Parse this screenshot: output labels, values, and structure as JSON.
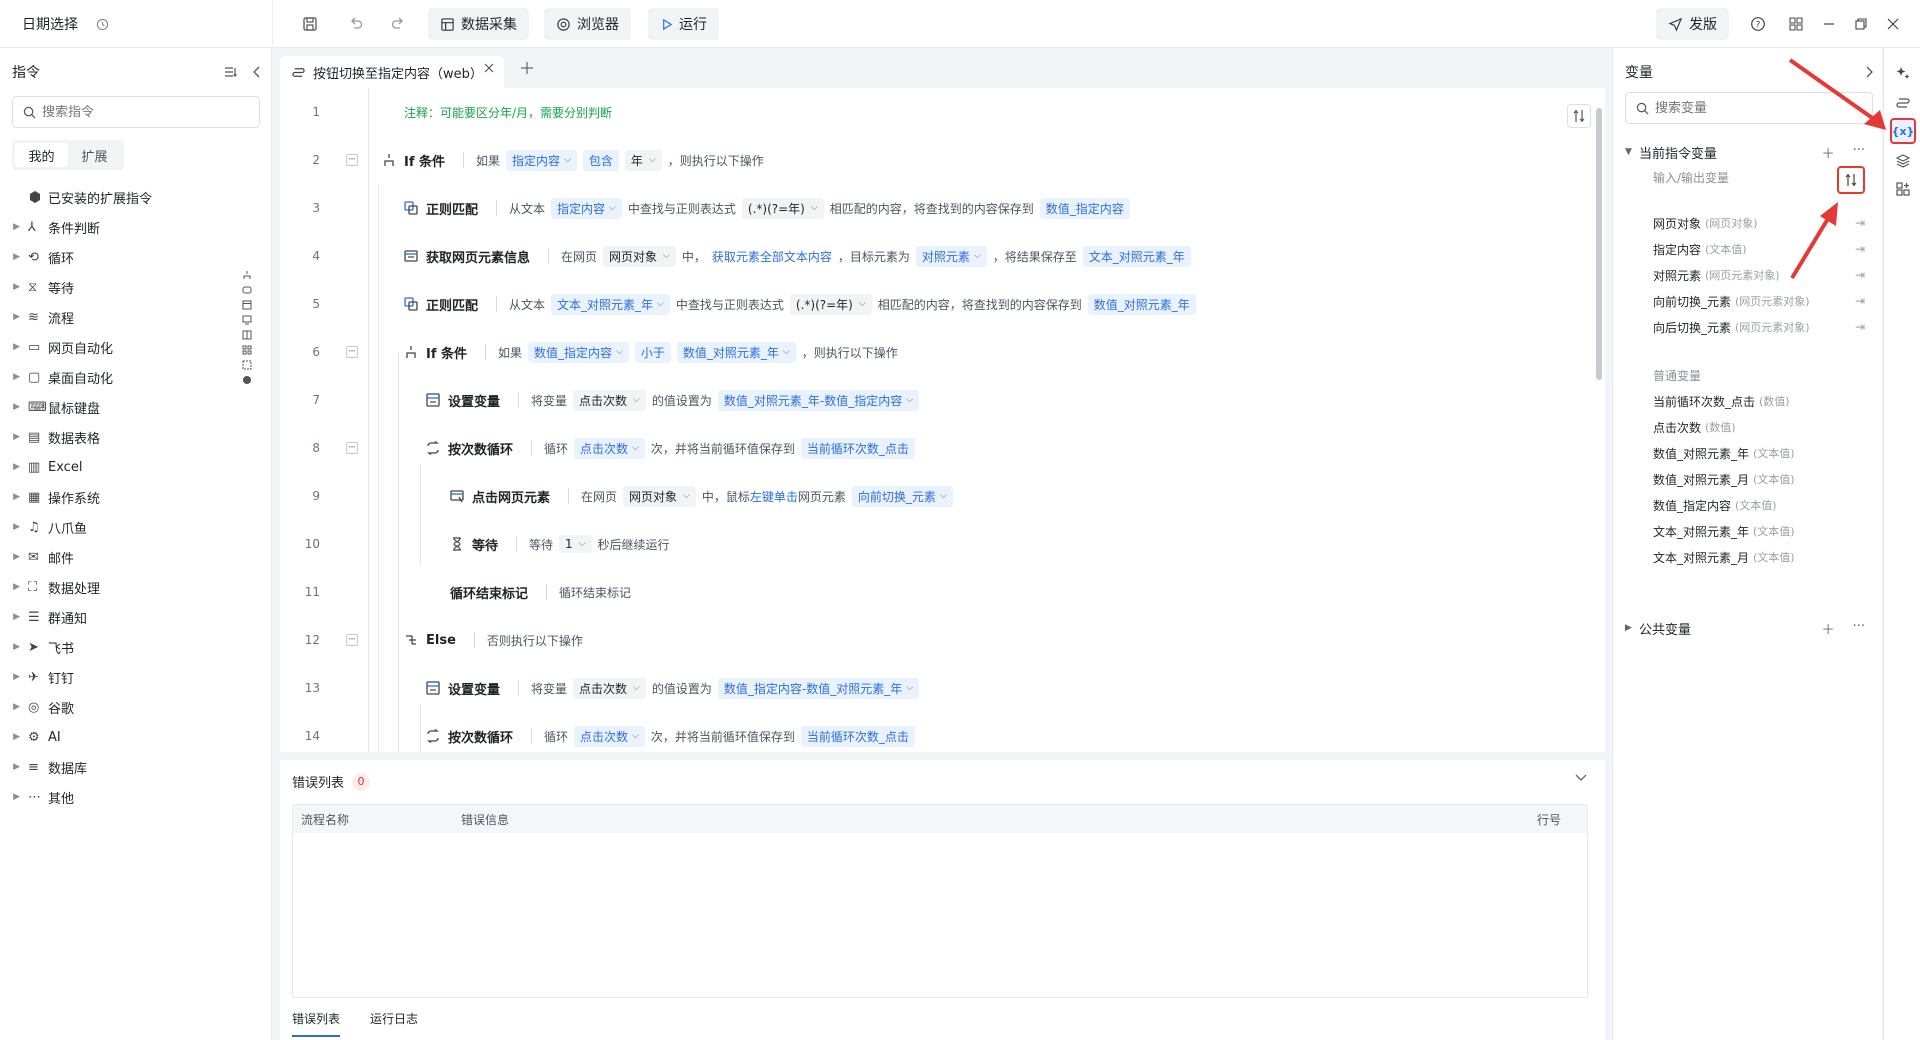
{
  "app": {
    "title": "日期选择"
  },
  "toolbar": {
    "data_collect": "数据采集",
    "browser": "浏览器",
    "run": "运行",
    "publish": "发版"
  },
  "left": {
    "title": "指令",
    "search_placeholder": "搜索指令",
    "tabs": [
      "我的",
      "扩展"
    ],
    "installed": "已安装的扩展指令",
    "items": [
      "条件判断",
      "循环",
      "等待",
      "流程",
      "网页自动化",
      "桌面自动化",
      "鼠标键盘",
      "数据表格",
      "Excel",
      "操作系统",
      "八爪鱼",
      "邮件",
      "数据处理",
      "群通知",
      "飞书",
      "钉钉",
      "谷歌",
      "AI",
      "数据库",
      "其他"
    ]
  },
  "editor": {
    "tab_title": "按钮切换至指定内容（web）",
    "lines": {
      "l1": {
        "comment": "注释：可能要区分年/月，需要分别判断"
      },
      "l2": {
        "cmd": "If 条件",
        "t1": "如果",
        "v1": "指定内容",
        "op": "包含",
        "v2": "年",
        "t2": "，则执行以下操作"
      },
      "l3": {
        "cmd": "正则匹配",
        "t1": "从文本",
        "v1": "指定内容",
        "t2": "中查找与正则表达式",
        "v2": "(.*)(?=年)",
        "t3": "相匹配的内容，将查找到的内容保存到",
        "v3": "数值_指定内容"
      },
      "l4": {
        "cmd": "获取网页元素信息",
        "t1": "在网页",
        "v1": "网页对象",
        "t2": "中，",
        "link": "获取元素全部文本内容",
        "t3": "，目标元素为",
        "v2": "对照元素",
        "t4": "，将结果保存至",
        "v3": "文本_对照元素_年"
      },
      "l5": {
        "cmd": "正则匹配",
        "t1": "从文本",
        "v1": "文本_对照元素_年",
        "t2": "中查找与正则表达式",
        "v2": "(.*)(?=年)",
        "t3": "相匹配的内容，将查找到的内容保存到",
        "v3": "数值_对照元素_年"
      },
      "l6": {
        "cmd": "If 条件",
        "t1": "如果",
        "v1": "数值_指定内容",
        "op": "小于",
        "v2": "数值_对照元素_年",
        "t2": "，则执行以下操作"
      },
      "l7": {
        "cmd": "设置变量",
        "t1": "将变量",
        "v1": "点击次数",
        "t2": "的值设置为",
        "v2": "数值_对照元素_年-数值_指定内容"
      },
      "l8": {
        "cmd": "按次数循环",
        "t1": "循环",
        "v1": "点击次数",
        "t2": "次，并将当前循环值保存到",
        "v2": "当前循环次数_点击"
      },
      "l9": {
        "cmd": "点击网页元素",
        "t1": "在网页",
        "v1": "网页对象",
        "t2": "中，鼠标",
        "link": "左键单击",
        "t3": "网页元素",
        "v2": "向前切换_元素"
      },
      "l10": {
        "cmd": "等待",
        "t1": "等待",
        "v1": "1",
        "t2": "秒后继续运行"
      },
      "l11": {
        "cmd": "循环结束标记",
        "t1": "循环结束标记"
      },
      "l12": {
        "cmd": "Else",
        "t1": "否则执行以下操作"
      },
      "l13": {
        "cmd": "设置变量",
        "t1": "将变量",
        "v1": "点击次数",
        "t2": "的值设置为",
        "v2": "数值_指定内容-数值_对照元素_年"
      },
      "l14": {
        "cmd": "按次数循环",
        "t1": "循环",
        "v1": "点击次数",
        "t2": "次，并将当前循环值保存到",
        "v2": "当前循环次数_点击"
      }
    }
  },
  "errors": {
    "title": "错误列表",
    "count": "0",
    "col_name": "流程名称",
    "col_msg": "错误信息",
    "col_line": "行号",
    "tab_errors": "错误列表",
    "tab_log": "运行日志"
  },
  "vars": {
    "title": "变量",
    "search_placeholder": "搜索变量",
    "current_group": "当前指令变量",
    "io_head": "输入/输出变量",
    "io": [
      {
        "name": "网页对象",
        "type": "(网页对象)"
      },
      {
        "name": "指定内容",
        "type": "(文本值)"
      },
      {
        "name": "对照元素",
        "type": "(网页元素对象)"
      },
      {
        "name": "向前切换_元素",
        "type": "(网页元素对象)"
      },
      {
        "name": "向后切换_元素",
        "type": "(网页元素对象)"
      }
    ],
    "normal_head": "普通变量",
    "normal": [
      {
        "name": "当前循环次数_点击",
        "type": "(数值)"
      },
      {
        "name": "点击次数",
        "type": "(数值)"
      },
      {
        "name": "数值_对照元素_年",
        "type": "(文本值)"
      },
      {
        "name": "数值_对照元素_月",
        "type": "(文本值)"
      },
      {
        "name": "数值_指定内容",
        "type": "(文本值)"
      },
      {
        "name": "文本_对照元素_年",
        "type": "(文本值)"
      },
      {
        "name": "文本_对照元素_月",
        "type": "(文本值)"
      }
    ],
    "public_group": "公共变量"
  },
  "strip": {
    "var_label": "{x}"
  },
  "colors": {
    "accent": "#2a6fdb",
    "annotation": "#e53935",
    "comment": "#16a34a"
  }
}
